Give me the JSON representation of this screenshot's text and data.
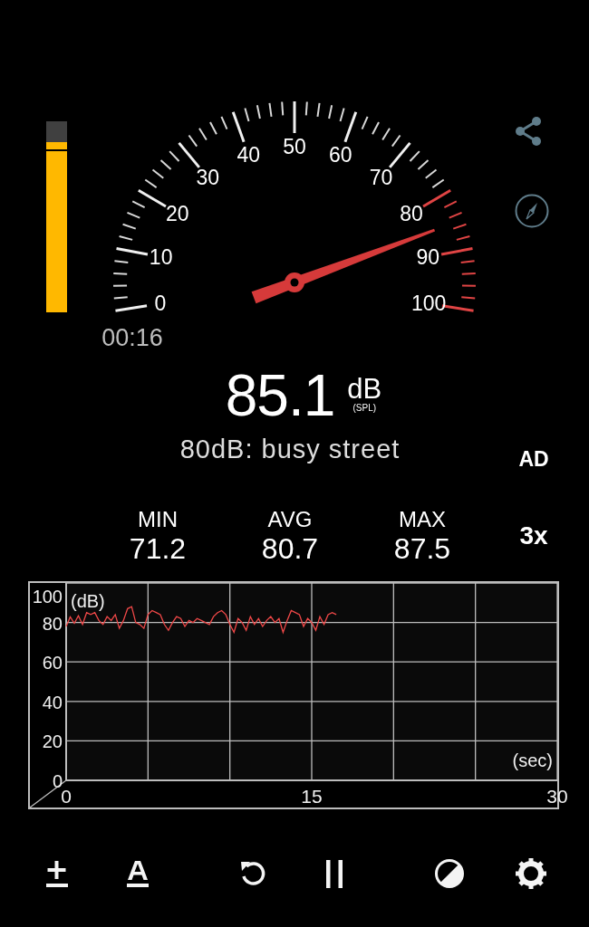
{
  "gauge": {
    "scale": [
      {
        "text": "0",
        "kind": "normal"
      },
      {
        "text": "10",
        "kind": "normal"
      },
      {
        "text": "20",
        "kind": "normal"
      },
      {
        "text": "30",
        "kind": "normal"
      },
      {
        "text": "40",
        "kind": "normal"
      },
      {
        "text": "50",
        "kind": "normal"
      },
      {
        "text": "60",
        "kind": "normal"
      },
      {
        "text": "70",
        "kind": "normal"
      },
      {
        "text": "80",
        "kind": "warning"
      },
      {
        "text": "90",
        "kind": "warning"
      },
      {
        "text": "100",
        "kind": "warning"
      }
    ]
  },
  "timer": "00:16",
  "reading": {
    "value": "85.1",
    "unit": "dB",
    "reference": "(SPL)"
  },
  "description": "80dB: busy street",
  "ad_label": "AD",
  "stats": [
    {
      "label": "MIN",
      "value": "71.2"
    },
    {
      "label": "AVG",
      "value": "80.7"
    },
    {
      "label": "MAX",
      "value": "87.5"
    }
  ],
  "speed": "3x",
  "chart": {
    "chart_data": {
      "type": "line",
      "grid": true,
      "xlabel": "(sec)",
      "ylabel": "(dB)",
      "xlim": [
        0,
        30
      ],
      "ylim": [
        0,
        100
      ],
      "xticks": [
        0,
        15,
        30
      ],
      "yticks": [
        0,
        20,
        40,
        60,
        80,
        100
      ],
      "x": [
        0,
        0.25,
        0.5,
        0.75,
        1,
        1.25,
        1.5,
        1.75,
        2,
        2.25,
        2.5,
        2.75,
        3,
        3.25,
        3.5,
        3.75,
        4,
        4.25,
        4.5,
        4.75,
        5,
        5.25,
        5.5,
        5.75,
        6,
        6.25,
        6.5,
        6.75,
        7,
        7.25,
        7.5,
        7.75,
        8,
        8.25,
        8.5,
        8.75,
        9,
        9.25,
        9.5,
        9.75,
        10,
        10.25,
        10.5,
        10.75,
        11,
        11.25,
        11.5,
        11.75,
        12,
        12.25,
        12.5,
        12.75,
        13,
        13.25,
        13.5,
        13.75,
        14,
        14.25,
        14.5,
        14.75,
        15,
        15.25,
        15.5,
        15.75,
        16,
        16.25,
        16.5
      ],
      "series": [
        {
          "color": "#f04848",
          "values": [
            78,
            82.8,
            79.6,
            83.4,
            79,
            85,
            84,
            85,
            81,
            79,
            83,
            81,
            84,
            77,
            81,
            87,
            88,
            80,
            79,
            77,
            84,
            86,
            85,
            84,
            79,
            76,
            80,
            83,
            82,
            78,
            81,
            80,
            82,
            81,
            80,
            79,
            83,
            85,
            86,
            84,
            79,
            75,
            82,
            80,
            76,
            83,
            79,
            82,
            78,
            81,
            83,
            80,
            82,
            75,
            81,
            86,
            85,
            84,
            78,
            82,
            80,
            76,
            83,
            79,
            84,
            85,
            84
          ]
        }
      ]
    }
  }
}
